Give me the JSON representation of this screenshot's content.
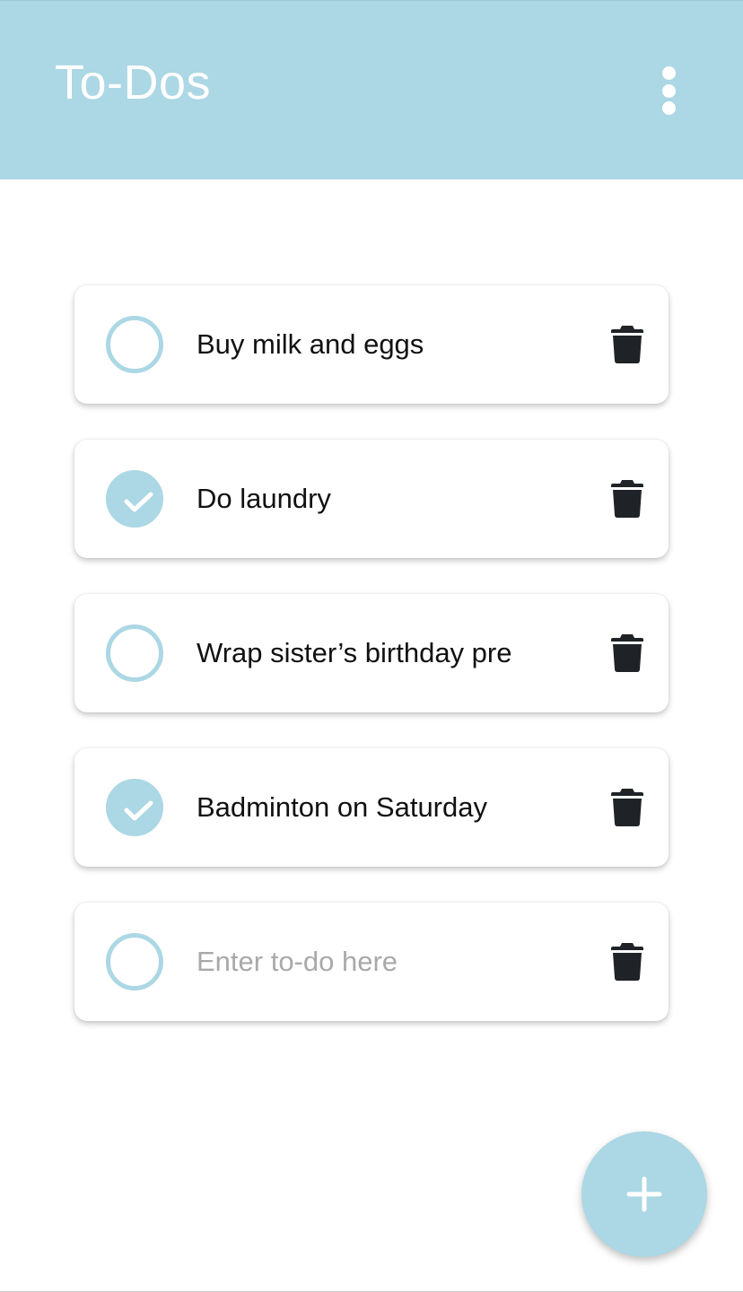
{
  "app_bar": {
    "title": "To-Dos",
    "menu_icon": "more-vert-icon",
    "color": "#acd7e4"
  },
  "todos": [
    {
      "text": "Buy milk and eggs",
      "done": false
    },
    {
      "text": "Do laundry",
      "done": true
    },
    {
      "text": "Wrap sister’s birthday present",
      "done": false
    },
    {
      "text": "Badminton on Saturday",
      "done": true
    }
  ],
  "new_todo": {
    "value": "",
    "placeholder": "Enter to-do here",
    "done": false
  },
  "icons": {
    "delete": "trash-icon",
    "check": "checkmark-icon",
    "add": "plus-icon"
  },
  "fab": {
    "icon": "plus-icon"
  },
  "colors": {
    "accent": "#acd7e4",
    "text": "#111111",
    "placeholder": "#a9a9a9",
    "icon": "#1f2327"
  }
}
